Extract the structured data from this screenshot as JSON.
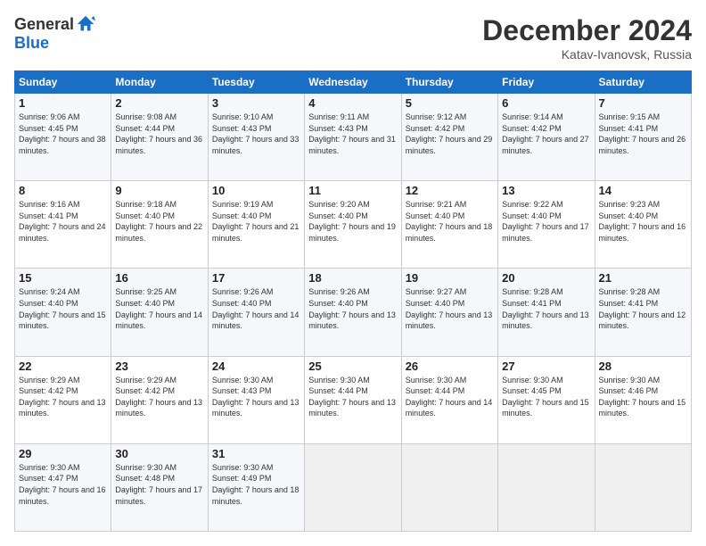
{
  "header": {
    "logo_general": "General",
    "logo_blue": "Blue",
    "month": "December 2024",
    "location": "Katav-Ivanovsk, Russia"
  },
  "days_of_week": [
    "Sunday",
    "Monday",
    "Tuesday",
    "Wednesday",
    "Thursday",
    "Friday",
    "Saturday"
  ],
  "weeks": [
    [
      {
        "day": "1",
        "sunrise": "9:06 AM",
        "sunset": "4:45 PM",
        "daylight": "7 hours and 38 minutes."
      },
      {
        "day": "2",
        "sunrise": "9:08 AM",
        "sunset": "4:44 PM",
        "daylight": "7 hours and 36 minutes."
      },
      {
        "day": "3",
        "sunrise": "9:10 AM",
        "sunset": "4:43 PM",
        "daylight": "7 hours and 33 minutes."
      },
      {
        "day": "4",
        "sunrise": "9:11 AM",
        "sunset": "4:43 PM",
        "daylight": "7 hours and 31 minutes."
      },
      {
        "day": "5",
        "sunrise": "9:12 AM",
        "sunset": "4:42 PM",
        "daylight": "7 hours and 29 minutes."
      },
      {
        "day": "6",
        "sunrise": "9:14 AM",
        "sunset": "4:42 PM",
        "daylight": "7 hours and 27 minutes."
      },
      {
        "day": "7",
        "sunrise": "9:15 AM",
        "sunset": "4:41 PM",
        "daylight": "7 hours and 26 minutes."
      }
    ],
    [
      {
        "day": "8",
        "sunrise": "9:16 AM",
        "sunset": "4:41 PM",
        "daylight": "7 hours and 24 minutes."
      },
      {
        "day": "9",
        "sunrise": "9:18 AM",
        "sunset": "4:40 PM",
        "daylight": "7 hours and 22 minutes."
      },
      {
        "day": "10",
        "sunrise": "9:19 AM",
        "sunset": "4:40 PM",
        "daylight": "7 hours and 21 minutes."
      },
      {
        "day": "11",
        "sunrise": "9:20 AM",
        "sunset": "4:40 PM",
        "daylight": "7 hours and 19 minutes."
      },
      {
        "day": "12",
        "sunrise": "9:21 AM",
        "sunset": "4:40 PM",
        "daylight": "7 hours and 18 minutes."
      },
      {
        "day": "13",
        "sunrise": "9:22 AM",
        "sunset": "4:40 PM",
        "daylight": "7 hours and 17 minutes."
      },
      {
        "day": "14",
        "sunrise": "9:23 AM",
        "sunset": "4:40 PM",
        "daylight": "7 hours and 16 minutes."
      }
    ],
    [
      {
        "day": "15",
        "sunrise": "9:24 AM",
        "sunset": "4:40 PM",
        "daylight": "7 hours and 15 minutes."
      },
      {
        "day": "16",
        "sunrise": "9:25 AM",
        "sunset": "4:40 PM",
        "daylight": "7 hours and 14 minutes."
      },
      {
        "day": "17",
        "sunrise": "9:26 AM",
        "sunset": "4:40 PM",
        "daylight": "7 hours and 14 minutes."
      },
      {
        "day": "18",
        "sunrise": "9:26 AM",
        "sunset": "4:40 PM",
        "daylight": "7 hours and 13 minutes."
      },
      {
        "day": "19",
        "sunrise": "9:27 AM",
        "sunset": "4:40 PM",
        "daylight": "7 hours and 13 minutes."
      },
      {
        "day": "20",
        "sunrise": "9:28 AM",
        "sunset": "4:41 PM",
        "daylight": "7 hours and 13 minutes."
      },
      {
        "day": "21",
        "sunrise": "9:28 AM",
        "sunset": "4:41 PM",
        "daylight": "7 hours and 12 minutes."
      }
    ],
    [
      {
        "day": "22",
        "sunrise": "9:29 AM",
        "sunset": "4:42 PM",
        "daylight": "7 hours and 13 minutes."
      },
      {
        "day": "23",
        "sunrise": "9:29 AM",
        "sunset": "4:42 PM",
        "daylight": "7 hours and 13 minutes."
      },
      {
        "day": "24",
        "sunrise": "9:30 AM",
        "sunset": "4:43 PM",
        "daylight": "7 hours and 13 minutes."
      },
      {
        "day": "25",
        "sunrise": "9:30 AM",
        "sunset": "4:44 PM",
        "daylight": "7 hours and 13 minutes."
      },
      {
        "day": "26",
        "sunrise": "9:30 AM",
        "sunset": "4:44 PM",
        "daylight": "7 hours and 14 minutes."
      },
      {
        "day": "27",
        "sunrise": "9:30 AM",
        "sunset": "4:45 PM",
        "daylight": "7 hours and 15 minutes."
      },
      {
        "day": "28",
        "sunrise": "9:30 AM",
        "sunset": "4:46 PM",
        "daylight": "7 hours and 15 minutes."
      }
    ],
    [
      {
        "day": "29",
        "sunrise": "9:30 AM",
        "sunset": "4:47 PM",
        "daylight": "7 hours and 16 minutes."
      },
      {
        "day": "30",
        "sunrise": "9:30 AM",
        "sunset": "4:48 PM",
        "daylight": "7 hours and 17 minutes."
      },
      {
        "day": "31",
        "sunrise": "9:30 AM",
        "sunset": "4:49 PM",
        "daylight": "7 hours and 18 minutes."
      },
      null,
      null,
      null,
      null
    ]
  ]
}
